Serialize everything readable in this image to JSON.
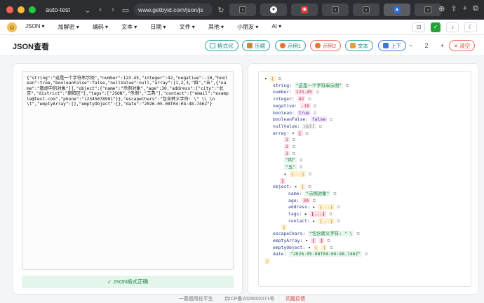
{
  "browser": {
    "tab_title": "auto-test",
    "url": "www.getbyid.com/json/js",
    "colors": {
      "close": "#ff5f57",
      "min": "#febc2e",
      "max": "#28c840"
    }
  },
  "nav": {
    "menu": [
      "JSON ▾",
      "加解密 ▾",
      "编码 ▾",
      "文本 ▾",
      "日期 ▾",
      "文件 ▾",
      "其他 ▾",
      "小朋友 ▾",
      "AI ▾"
    ]
  },
  "toolbar": {
    "title": "JSON查看",
    "buttons": [
      {
        "label": "格式化",
        "icon": "format-icon"
      },
      {
        "label": "压缩",
        "icon": "compress-icon"
      },
      {
        "label": "示例1",
        "icon": "example-icon"
      },
      {
        "label": "示例2",
        "icon": "example-icon"
      },
      {
        "label": "文本",
        "icon": "text-icon"
      },
      {
        "label": "上下",
        "icon": "layout-icon"
      }
    ],
    "stepper": {
      "minus": "−",
      "value": "2",
      "plus": "+"
    },
    "clear": "✕ 清空"
  },
  "input": {
    "text": "{\"string\":\"这是一个字符串示例\",\"number\":123.45,\"integer\":42,\"negative\":-10,\"boolean\":true,\"booleanFalse\":false,\"nullValue\":null,\"array\":[1,2,3,\"四\",\"五\",{\"name\":\"数组中的对象\"}],\"object\":{\"name\":\"示例对象\",\"age\":30,\"address\":{\"city\":\"北京\",\"district\":\"朝阳区\"},\"tags\":[\"JSON\",\"示例\",\"工具\"],\"contact\":{\"email\":\"example@test.com\",\"phone\":\"12345678901\"}},\"escapeChars\":\"包含转义字符: \\\" \\\\ \\n \\t\",\"emptyArray\":[],\"emptyObject\":{},\"date\":\"2026-05-08T04:04:48.746Z\"}",
    "status": "✓ JSON格式正确"
  },
  "tree": {
    "string_key": "string:",
    "string_val": "\"这是一个字符串示例\"",
    "number_key": "number:",
    "number_val": "123.45",
    "integer_key": "integer:",
    "integer_val": "42",
    "negative_key": "negative:",
    "negative_val": "-10",
    "boolean_key": "boolean:",
    "boolean_val": "true",
    "booleanFalse_key": "booleanFalse:",
    "booleanFalse_val": "false",
    "nullValue_key": "nullValue:",
    "nullValue_val": "null",
    "array_key": "array:",
    "arr1": "1",
    "arr2": "2",
    "arr3": "3",
    "arr4": "\"四\"",
    "arr5": "\"五\"",
    "arr6": "{...}",
    "object_key": "object:",
    "name_key": "name:",
    "name_val": "\"示例对象\"",
    "age_key": "age:",
    "age_val": "30",
    "address_key": "address:",
    "address_val": "{...}",
    "tags_key": "tags:",
    "tags_val": "[...]",
    "contact_key": "contact:",
    "contact_val": "{...}",
    "escape_key": "escapeChars:",
    "escape_val": "\"包含转义字符: \" \\",
    "emptyArray_key": "emptyArray:",
    "emptyObject_key": "emptyObject:",
    "date_key": "date:",
    "date_val": "\"2026-05-08T04:04:48.746Z\""
  },
  "footer": {
    "author": "一蓑烟雨任平生",
    "icp": "京ICP备2026002071号",
    "feedback": "问题反馈"
  }
}
